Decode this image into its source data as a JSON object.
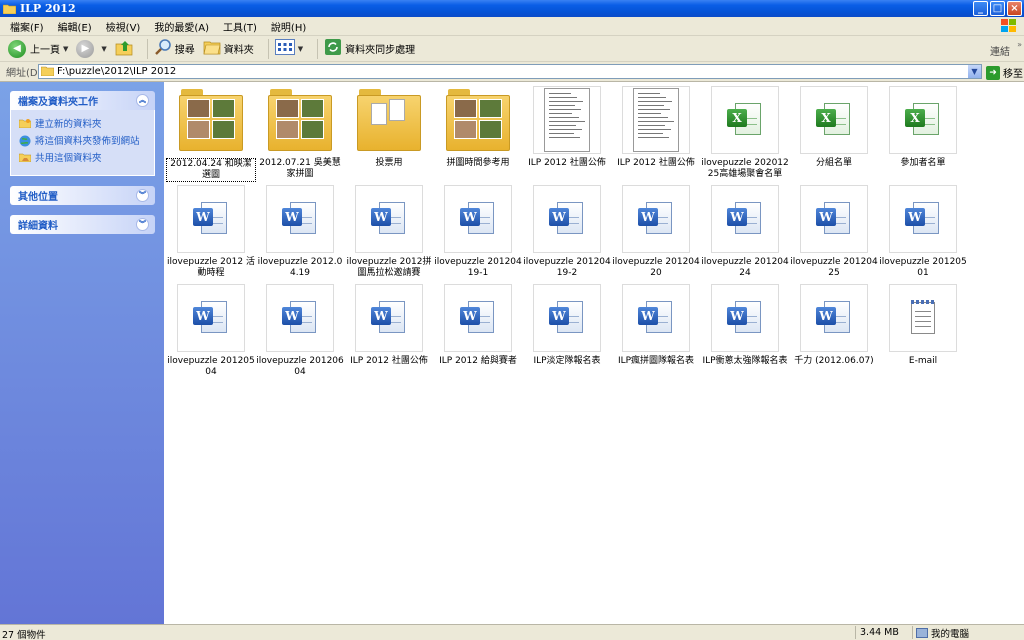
{
  "window": {
    "title": "ILP 2012"
  },
  "menu": [
    "檔案(F)",
    "編輯(E)",
    "檢視(V)",
    "我的最愛(A)",
    "工具(T)",
    "說明(H)"
  ],
  "toolbar": {
    "back": "上一頁",
    "search": "搜尋",
    "folders": "資料夾",
    "sync": "資料夾同步處理",
    "connect": "連結"
  },
  "address": {
    "label": "網址(D)",
    "path": "F:\\puzzle\\2012\\ILP 2012",
    "go": "移至"
  },
  "tasks": {
    "file_tasks": {
      "title": "檔案及資料夾工作",
      "items": [
        "建立新的資料夾",
        "將這個資料夾發佈到網站",
        "共用這個資料夾"
      ]
    },
    "other_places": {
      "title": "其他位置"
    },
    "details": {
      "title": "詳細資料"
    }
  },
  "files": [
    {
      "name": "2012.04.24 和映潔選圖",
      "type": "folder-photos",
      "selected": true
    },
    {
      "name": "2012.07.21 吳美慧家拼圖",
      "type": "folder-photos",
      "selected": false
    },
    {
      "name": "投票用",
      "type": "folder-docs",
      "selected": false
    },
    {
      "name": "拼圖時間參考用",
      "type": "folder-photos",
      "selected": false
    },
    {
      "name": "ILP 2012 社團公佈",
      "type": "docpreview",
      "selected": false
    },
    {
      "name": "ILP 2012 社團公佈",
      "type": "docpreview",
      "selected": false
    },
    {
      "name": "ilovepuzzle 20201225高雄場聚會名單",
      "type": "excel",
      "selected": false
    },
    {
      "name": "分組名單",
      "type": "excel",
      "selected": false
    },
    {
      "name": "參加者名單",
      "type": "excel",
      "selected": false
    },
    {
      "name": "ilovepuzzle 2012 活動時程",
      "type": "word",
      "selected": false
    },
    {
      "name": "ilovepuzzle 2012.04.19",
      "type": "word",
      "selected": false
    },
    {
      "name": "ilovepuzzle 2012拼圖馬拉松邀請賽",
      "type": "word",
      "selected": false
    },
    {
      "name": "ilovepuzzle 20120419-1",
      "type": "word",
      "selected": false
    },
    {
      "name": "ilovepuzzle 20120419-2",
      "type": "word",
      "selected": false
    },
    {
      "name": "ilovepuzzle 20120420",
      "type": "word",
      "selected": false
    },
    {
      "name": "ilovepuzzle 20120424",
      "type": "word",
      "selected": false
    },
    {
      "name": "ilovepuzzle 20120425",
      "type": "word",
      "selected": false
    },
    {
      "name": "ilovepuzzle 20120501",
      "type": "word",
      "selected": false
    },
    {
      "name": "ilovepuzzle 20120504",
      "type": "word",
      "selected": false
    },
    {
      "name": "ilovepuzzle 20120604",
      "type": "word",
      "selected": false
    },
    {
      "name": "ILP 2012 社團公佈",
      "type": "word",
      "selected": false
    },
    {
      "name": "ILP 2012 給與賽者",
      "type": "word",
      "selected": false
    },
    {
      "name": "ILP淡定隊報名表",
      "type": "word",
      "selected": false
    },
    {
      "name": "ILP瘋拼圖隊報名表",
      "type": "word",
      "selected": false
    },
    {
      "name": "ILP衝蔥太強隊報名表",
      "type": "word",
      "selected": false
    },
    {
      "name": "千力 (2012.06.07)",
      "type": "word",
      "selected": false
    },
    {
      "name": "E-mail",
      "type": "notepad",
      "selected": false
    }
  ],
  "status": {
    "count": "27 個物件",
    "size": "3.44 MB",
    "zone": "我的電腦"
  },
  "colors": {
    "title_bar": "#0553d6",
    "task_pane": "#6375d6",
    "link": "#215dc6"
  }
}
